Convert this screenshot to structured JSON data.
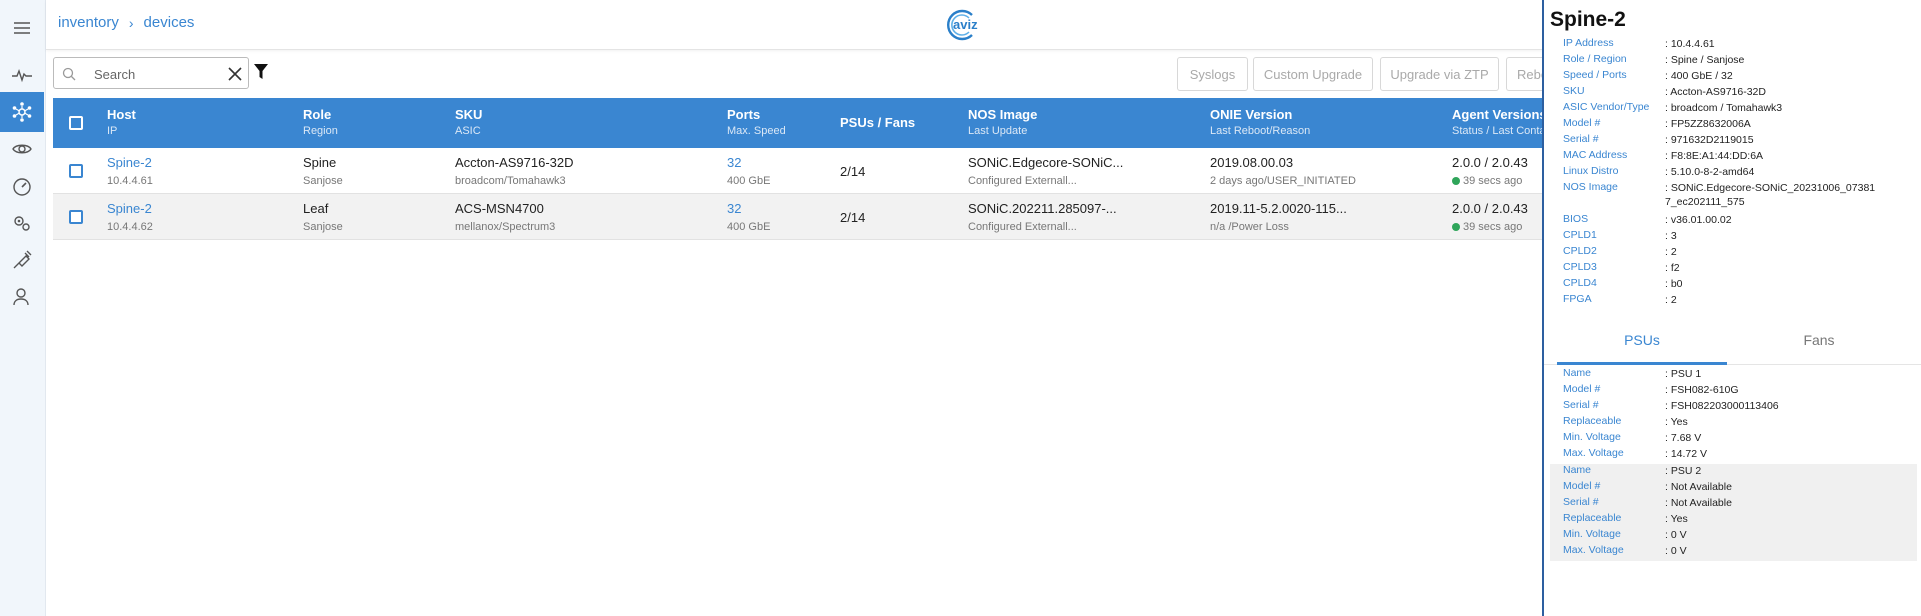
{
  "breadcrumb": {
    "root": "inventory",
    "current": "devices"
  },
  "logo": {
    "text": "aviz"
  },
  "search": {
    "placeholder": "Search"
  },
  "actions": [
    {
      "label": "Syslogs"
    },
    {
      "label": "Custom Upgrade"
    },
    {
      "label": "Upgrade via ZTP"
    },
    {
      "label": "Reboot"
    }
  ],
  "table": {
    "headers": [
      {
        "title": "Host",
        "sub": "IP"
      },
      {
        "title": "Role",
        "sub": "Region"
      },
      {
        "title": "SKU",
        "sub": "ASIC"
      },
      {
        "title": "Ports",
        "sub": "Max. Speed"
      },
      {
        "title": "PSUs / Fans",
        "sub": ""
      },
      {
        "title": "NOS Image",
        "sub": "Last Update"
      },
      {
        "title": "ONIE Version",
        "sub": "Last Reboot/Reason"
      },
      {
        "title": "Agent Versions",
        "sub": "Status / Last Contact"
      }
    ],
    "rows": [
      {
        "host": "Spine-2",
        "ip": "10.4.4.61",
        "role": "Spine",
        "region": "Sanjose",
        "sku": "Accton-AS9716-32D",
        "asic": "broadcom/Tomahawk3",
        "ports": "32",
        "speed": "400 GbE",
        "psus_fans": "2/14",
        "nos": "SONiC.Edgecore-SONiC...",
        "nos_update": "Configured Externall...",
        "onie": "2019.08.00.03",
        "reboot": "2 days ago/USER_INITIATED",
        "agent": "2.0.0 / 2.0.43",
        "contact": "39 secs ago"
      },
      {
        "host": "Spine-2",
        "ip": "10.4.4.62",
        "role": "Leaf",
        "region": "Sanjose",
        "sku": "ACS-MSN4700",
        "asic": "mellanox/Spectrum3",
        "ports": "32",
        "speed": "400 GbE",
        "psus_fans": "2/14",
        "nos": "SONiC.202211.285097-...",
        "nos_update": "Configured Externall...",
        "onie": "2019.11-5.2.0020-115...",
        "reboot": "n/a /Power Loss",
        "agent": "2.0.0 / 2.0.43",
        "contact": "39 secs ago"
      }
    ]
  },
  "detail": {
    "title": "Spine-2",
    "fields": [
      {
        "key": "IP Address",
        "value": ": 10.4.4.61"
      },
      {
        "key": "Role / Region",
        "value": ": Spine / Sanjose"
      },
      {
        "key": "Speed / Ports",
        "value": ": 400 GbE / 32"
      },
      {
        "key": "SKU",
        "value": ": Accton-AS9716-32D"
      },
      {
        "key": "ASIC Vendor/Type",
        "value": ": broadcom / Tomahawk3"
      },
      {
        "key": "Model #",
        "value": ": FP5ZZ8632006A"
      },
      {
        "key": "Serial #",
        "value": ": 971632D2119015"
      },
      {
        "key": "MAC Address",
        "value": ": F8:8E:A1:44:DD:6A"
      },
      {
        "key": "Linux Distro",
        "value": ": 5.10.0-8-2-amd64"
      },
      {
        "key": "NOS Image",
        "value": ": SONiC.Edgecore-SONiC_20231006_073817_ec202111_575"
      },
      {
        "key": "BIOS",
        "value": ": v36.01.00.02"
      },
      {
        "key": "CPLD1",
        "value": ": 3"
      },
      {
        "key": "CPLD2",
        "value": ": 2"
      },
      {
        "key": "CPLD3",
        "value": ": f2"
      },
      {
        "key": "CPLD4",
        "value": ": b0"
      },
      {
        "key": "FPGA",
        "value": ": 2"
      }
    ],
    "tabs": [
      {
        "label": "PSUs"
      },
      {
        "label": "Fans"
      }
    ],
    "psus": [
      [
        {
          "key": "Name",
          "value": ": PSU 1"
        },
        {
          "key": "Model #",
          "value": ": FSH082-610G"
        },
        {
          "key": "Serial #",
          "value": ": FSH082203000113406"
        },
        {
          "key": "Replaceable",
          "value": ": Yes"
        },
        {
          "key": "Min. Voltage",
          "value": ": 7.68 V"
        },
        {
          "key": "Max. Voltage",
          "value": ": 14.72 V"
        }
      ],
      [
        {
          "key": "Name",
          "value": ": PSU 2"
        },
        {
          "key": "Model #",
          "value": ": Not Available"
        },
        {
          "key": "Serial #",
          "value": ": Not Available"
        },
        {
          "key": "Replaceable",
          "value": ": Yes"
        },
        {
          "key": "Min. Voltage",
          "value": ": 0 V"
        },
        {
          "key": "Max. Voltage",
          "value": ": 0 V"
        }
      ]
    ]
  }
}
